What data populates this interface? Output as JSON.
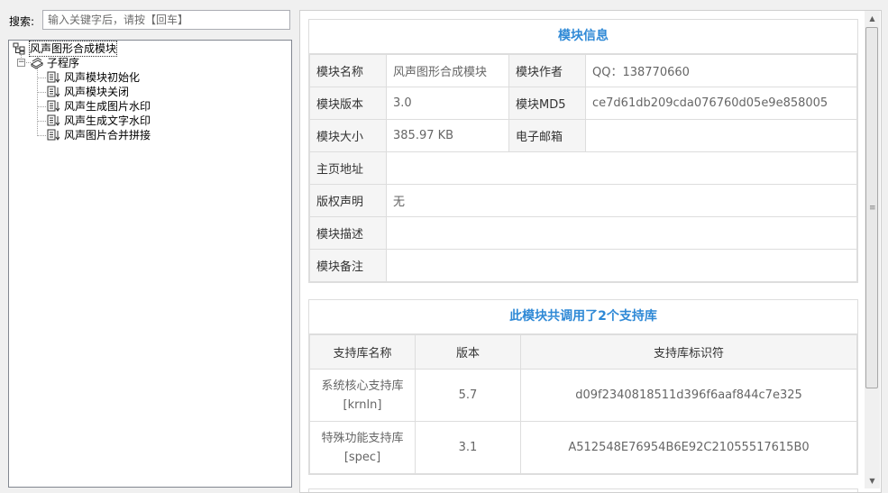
{
  "search": {
    "label": "搜索:",
    "placeholder": "输入关键字后，请按【回车】"
  },
  "tree": {
    "root": "风声图形合成模块",
    "group": "子程序",
    "items": [
      "风声模块初始化",
      "风声模块关闭",
      "风声生成图片水印",
      "风声生成文字水印",
      "风声图片合并拼接"
    ]
  },
  "module_info": {
    "title": "模块信息",
    "name_label": "模块名称",
    "name": "风声图形合成模块",
    "author_label": "模块作者",
    "author": "QQ：138770660",
    "version_label": "模块版本",
    "version": "3.0",
    "md5_label": "模块MD5",
    "md5": "ce7d61db209cda076760d05e9e858005",
    "size_label": "模块大小",
    "size": "385.97 KB",
    "email_label": "电子邮箱",
    "email": "",
    "homepage_label": "主页地址",
    "homepage": "",
    "copyright_label": "版权声明",
    "copyright": "无",
    "description_label": "模块描述",
    "description": "",
    "remarks_label": "模块备注",
    "remarks": ""
  },
  "libraries": {
    "title": "此模块共调用了2个支持库",
    "headers": [
      "支持库名称",
      "版本",
      "支持库标识符"
    ],
    "rows": [
      {
        "name": "系统核心支持库",
        "id": "[krnln]",
        "version": "5.7",
        "guid": "d09f2340818511d396f6aaf844c7e325"
      },
      {
        "name": "特殊功能支持库",
        "id": "[spec]",
        "version": "3.1",
        "guid": "A512548E76954B6E92C21055517615B0"
      }
    ]
  },
  "icons": {
    "tree_root": "module-tree-icon",
    "tree_group": "books-icon",
    "tree_item": "subroutine-icon",
    "scroll_up": "scroll-up-arrow",
    "scroll_down": "scroll-down-arrow",
    "scroll_grip": "scroll-grip"
  },
  "colors": {
    "title_blue": "#2f89d6",
    "header_bg": "#f5f5f5",
    "border": "#dddddd"
  }
}
